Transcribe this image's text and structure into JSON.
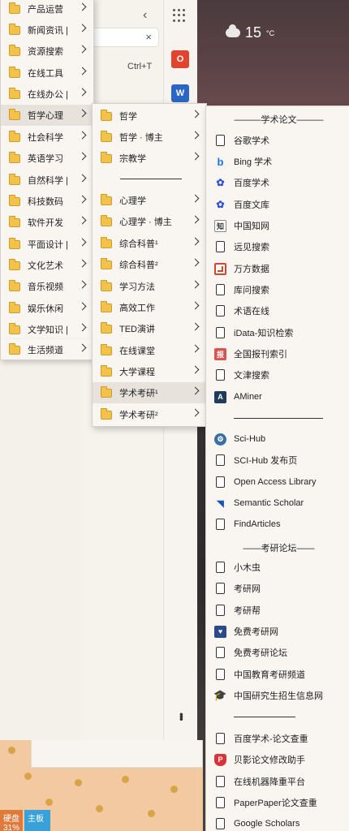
{
  "weather": {
    "temperature": "15",
    "unit": "°C"
  },
  "browser": {
    "new_tab_shortcut": "Ctrl+T",
    "office_icon": "office-logo",
    "word_icon": "word-logo"
  },
  "taskbar": {
    "tile1_label": "硬盘",
    "tile1_value": "31%",
    "tile2_label": "主板"
  },
  "menu_l1": {
    "items": [
      {
        "label": "产品运营"
      },
      {
        "label": "新闻资讯 |"
      },
      {
        "label": "资源搜索"
      },
      {
        "label": "在线工具"
      },
      {
        "label": "在线办公 |"
      },
      {
        "label": "哲学心理"
      },
      {
        "label": "社会科学"
      },
      {
        "label": "英语学习"
      },
      {
        "label": "自然科学 |"
      },
      {
        "label": "科技数码"
      },
      {
        "label": "软件开发"
      },
      {
        "label": "平面设计 |"
      },
      {
        "label": "文化艺术"
      },
      {
        "label": "音乐视频"
      },
      {
        "label": "娱乐休闲"
      },
      {
        "label": "文学知识 |"
      },
      {
        "label": "生活频道"
      }
    ]
  },
  "menu_l2": {
    "items_top": [
      {
        "label": "哲学"
      },
      {
        "label": "哲学 · 博主"
      },
      {
        "label": "宗教学"
      }
    ],
    "items_bottom": [
      {
        "label": "心理学"
      },
      {
        "label": "心理学 · 博主"
      },
      {
        "label": "综合科普¹"
      },
      {
        "label": "综合科普²"
      },
      {
        "label": "学习方法"
      },
      {
        "label": "高效工作"
      },
      {
        "label": "TED演讲"
      },
      {
        "label": "在线课堂"
      },
      {
        "label": "大学课程"
      },
      {
        "label": "学术考研¹"
      },
      {
        "label": "学术考研²"
      }
    ]
  },
  "menu_l3": {
    "heading_papers": "学术论文",
    "papers": [
      {
        "label": "谷歌学术",
        "icon": "page-icon"
      },
      {
        "label": "Bing 学术",
        "icon": "bing-icon"
      },
      {
        "label": "百度学术",
        "icon": "baidu-icon"
      },
      {
        "label": "百度文库",
        "icon": "baidu-icon"
      },
      {
        "label": "中国知网",
        "icon": "cnki-icon"
      },
      {
        "label": "远见搜索",
        "icon": "page-icon"
      },
      {
        "label": "万方数据",
        "icon": "wanfang-icon"
      },
      {
        "label": "库问搜索",
        "icon": "page-icon"
      },
      {
        "label": "术语在线",
        "icon": "page-icon"
      },
      {
        "label": "iData-知识检索",
        "icon": "page-icon"
      },
      {
        "label": "全国报刊索引",
        "icon": "cnbksy-icon"
      },
      {
        "label": "文津搜索",
        "icon": "page-icon"
      },
      {
        "label": "AMiner",
        "icon": "aminer-icon"
      }
    ],
    "papers_more": [
      {
        "label": "Sci-Hub",
        "icon": "scihub-icon"
      },
      {
        "label": "SCI-Hub 发布页",
        "icon": "page-icon"
      },
      {
        "label": "Open Access Library",
        "icon": "page-icon"
      },
      {
        "label": "Semantic Scholar",
        "icon": "semantic-scholar-icon"
      },
      {
        "label": "FindArticles",
        "icon": "page-icon"
      }
    ],
    "heading_forums": "考研论坛",
    "forums": [
      {
        "label": "小木虫",
        "icon": "page-icon"
      },
      {
        "label": "考研网",
        "icon": "page-icon"
      },
      {
        "label": "考研帮",
        "icon": "page-icon"
      },
      {
        "label": "免费考研网",
        "icon": "heart-icon"
      },
      {
        "label": "免费考研论坛",
        "icon": "page-icon"
      },
      {
        "label": "中国教育考研频道",
        "icon": "page-icon"
      },
      {
        "label": "中国研究生招生信息网",
        "icon": "graduation-cap-icon"
      }
    ],
    "tools": [
      {
        "label": "百度学术-论文查重",
        "icon": "page-icon"
      },
      {
        "label": "贝影论文修改助手",
        "icon": "shield-icon"
      },
      {
        "label": "在线机器降重平台",
        "icon": "page-icon"
      },
      {
        "label": "PaperPaper论文查重",
        "icon": "page-icon"
      },
      {
        "label": "Google Scholars",
        "icon": "page-icon"
      }
    ]
  }
}
